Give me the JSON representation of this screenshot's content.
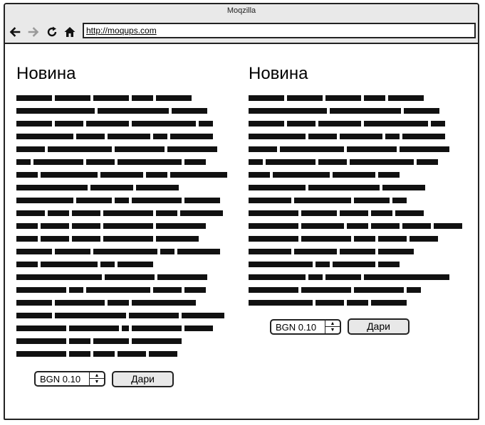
{
  "window": {
    "title": "Moqzilla"
  },
  "toolbar": {
    "back_icon": "arrow-left-icon",
    "forward_icon": "arrow-right-icon",
    "reload_icon": "reload-icon",
    "home_icon": "home-icon",
    "url": "http://moqups.com"
  },
  "articles": [
    {
      "title": "Новина",
      "amount": "BGN 0.10",
      "button_label": "Дари"
    },
    {
      "title": "Новина",
      "amount": "BGN 0.10",
      "button_label": "Дари"
    }
  ],
  "colors": {
    "chrome": "#e9e9e9",
    "border": "#222222",
    "button": "#e8e8e8"
  }
}
